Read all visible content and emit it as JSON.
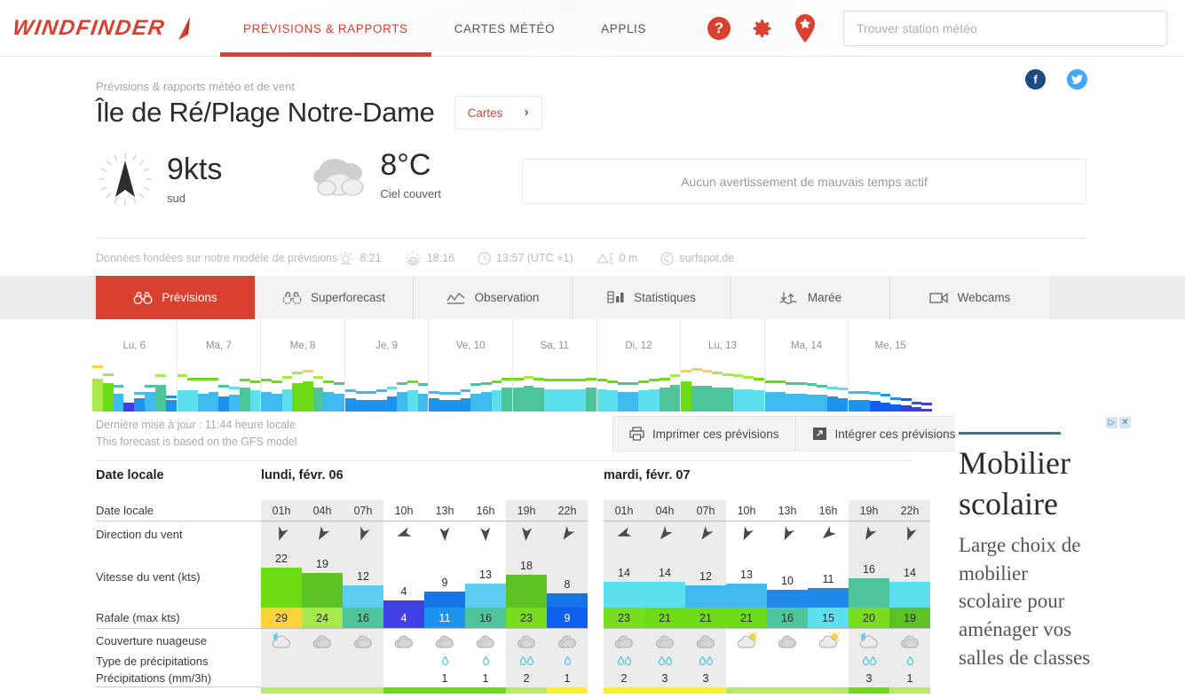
{
  "nav": {
    "logo_text": "WINDFINDER",
    "links": [
      {
        "label": "PRÉVISIONS & RAPPORTS",
        "active": true
      },
      {
        "label": "CARTES MÉTÉO",
        "active": false
      },
      {
        "label": "APPLIS",
        "active": false
      }
    ],
    "icons": [
      "help-icon",
      "gear-icon",
      "favorite-pin-icon"
    ],
    "search_placeholder": "Trouver station météo",
    "search_value": ""
  },
  "header": {
    "breadcrumb": "Prévisions & rapports météo et de vent",
    "title": "Île de Ré/Plage Notre-Dame",
    "cartes_label": "Cartes",
    "cartes_chevron": "›",
    "social": [
      {
        "name": "facebook-icon",
        "glyph": "f",
        "color": "#1d4a84"
      },
      {
        "name": "twitter-icon",
        "glyph": "ᴠ",
        "color": "#3fa9f5"
      }
    ]
  },
  "current": {
    "wind_value": "9kts",
    "wind_dir_label": "sud",
    "temp_value": "8°C",
    "sky_label": "Ciel couvert",
    "warning": "Aucun avertissement de mauvais temps actif"
  },
  "info_strip": {
    "model_text": "Données fondées sur notre modèle de prévisions",
    "items": [
      {
        "icon": "sunrise-icon",
        "value": "8:21"
      },
      {
        "icon": "sunset-icon",
        "value": "18:16"
      },
      {
        "icon": "clock-icon",
        "value": "13:57 (UTC +1)"
      },
      {
        "icon": "altitude-icon",
        "value": "0 m"
      },
      {
        "icon": "copyright-icon",
        "value": "surfspot.de"
      }
    ]
  },
  "tabs": [
    {
      "label": "Prévisions",
      "icon": "binoculars-icon",
      "active": true
    },
    {
      "label": "Superforecast",
      "icon": "binoculars-dotted-icon",
      "active": false
    },
    {
      "label": "Observation",
      "icon": "chart-line-icon",
      "active": false
    },
    {
      "label": "Statistiques",
      "icon": "bar-chart-icon",
      "active": false
    },
    {
      "label": "Marée",
      "icon": "tide-arrows-icon",
      "active": false
    },
    {
      "label": "Webcams",
      "icon": "webcam-icon",
      "active": false
    }
  ],
  "overview": {
    "days": [
      "Lu, 6",
      "Ma, 7",
      "Me, 8",
      "Je, 9",
      "Ve, 10",
      "Sa, 11",
      "Di, 12",
      "Lu, 13",
      "Ma, 14",
      "Me, 15"
    ],
    "series": [
      {
        "day": "Lu, 6",
        "wind": [
          22,
          19,
          12,
          4,
          9,
          13,
          18,
          8
        ],
        "gust": [
          29,
          24,
          16,
          4,
          11,
          16,
          23,
          9
        ]
      },
      {
        "day": "Ma, 7",
        "wind": [
          14,
          14,
          12,
          13,
          10,
          11,
          16,
          14
        ],
        "gust": [
          23,
          21,
          21,
          21,
          16,
          15,
          20,
          19
        ]
      },
      {
        "day": "Me, 8",
        "wind": [
          13,
          12,
          15,
          19,
          20,
          16,
          13,
          12
        ],
        "gust": [
          20,
          19,
          22,
          25,
          26,
          22,
          19,
          18
        ]
      },
      {
        "day": "Je, 9",
        "wind": [
          9,
          8,
          8,
          8,
          10,
          13,
          14,
          12
        ],
        "gust": [
          13,
          12,
          12,
          13,
          15,
          18,
          19,
          17
        ]
      },
      {
        "day": "Ve, 10",
        "wind": [
          9,
          8,
          8,
          9,
          12,
          13,
          14,
          16
        ],
        "gust": [
          12,
          11,
          11,
          13,
          17,
          18,
          19,
          21
        ]
      },
      {
        "day": "Sa, 11",
        "wind": [
          16,
          17,
          16,
          15,
          15,
          15,
          15,
          16
        ],
        "gust": [
          21,
          22,
          21,
          20,
          20,
          20,
          20,
          21
        ]
      },
      {
        "day": "Di, 12",
        "wind": [
          15,
          14,
          13,
          13,
          14,
          15,
          16,
          18
        ],
        "gust": [
          20,
          19,
          18,
          18,
          19,
          20,
          21,
          23
        ]
      },
      {
        "day": "Lu, 13",
        "wind": [
          20,
          17,
          17,
          16,
          16,
          15,
          15,
          14
        ],
        "gust": [
          26,
          27,
          26,
          25,
          24,
          23,
          22,
          21
        ]
      },
      {
        "day": "Ma, 14",
        "wind": [
          13,
          13,
          12,
          12,
          11,
          11,
          10,
          9
        ],
        "gust": [
          19,
          19,
          18,
          18,
          17,
          16,
          15,
          14
        ]
      },
      {
        "day": "Me, 15",
        "wind": [
          8,
          8,
          7,
          6,
          5,
          4,
          3,
          2
        ],
        "gust": [
          12,
          12,
          11,
          10,
          8,
          7,
          5,
          4
        ]
      }
    ]
  },
  "update": {
    "line1": "Dernière mise à jour : 11:44 heure locale",
    "line2": "This forecast is based on the GFS model"
  },
  "actions": [
    {
      "label": "Imprimer ces prévisions",
      "icon": "printer-icon"
    },
    {
      "label": "Intégrer ces prévisions",
      "icon": "embed-icon"
    }
  ],
  "forecast": {
    "section_title": "Date locale",
    "row_labels": [
      "Date locale",
      "Direction du vent",
      "Vitesse du vent  (kts)",
      "Rafale  (max kts)",
      "Couverture nuageuse",
      "Type de précipitations",
      "Précipitations  (mm/3h)"
    ],
    "times": [
      "01h",
      "04h",
      "07h",
      "10h",
      "13h",
      "16h",
      "19h",
      "22h"
    ],
    "shaded_cols": [
      0,
      1,
      2,
      6,
      7
    ],
    "days": [
      {
        "title": "lundi, févr. 06",
        "wind_dir_deg": [
          200,
          210,
          200,
          250,
          178,
          178,
          185,
          215
        ],
        "wind_speed": [
          22,
          19,
          12,
          4,
          9,
          13,
          18,
          8
        ],
        "wind_colors": [
          "#6bdd10",
          "#5cc122",
          "#5ccdee",
          "#3f3fe0",
          "#1574e6",
          "#5ccdee",
          "#5cc122",
          "#1574e6"
        ],
        "gust": [
          29,
          24,
          16,
          4,
          11,
          16,
          23,
          9
        ],
        "gust_colors": [
          "#ffd23b",
          "#a9e84a",
          "#4ec49a",
          "#4040e8",
          "#1d93ee",
          "#4ec49a",
          "#78dd1e",
          "#1060ef"
        ],
        "gust_text_colors": [
          "#2b2b2b",
          "#2b2b2b",
          "#2b2b2b",
          "#ffffff",
          "#ffffff",
          "#2b2b2b",
          "#2b2b2b",
          "#ffffff"
        ],
        "cloud": [
          "moon-cloud",
          "cloud",
          "cloud",
          "cloud",
          "cloud",
          "cloud",
          "cloud",
          "cloud"
        ],
        "precip_type": [
          0,
          0,
          0,
          0,
          1,
          1,
          2,
          1
        ],
        "precip": [
          "",
          "",
          "",
          "",
          "1",
          "1",
          "2",
          "1"
        ],
        "temp_colors": [
          "#b6e86a",
          "#b6e86a",
          "#b6e86a",
          "#6edb18",
          "#6edb18",
          "#6edb18",
          "#b6e86a",
          "#ffee22"
        ]
      },
      {
        "title": "mardi, févr. 07",
        "wind_dir_deg": [
          250,
          220,
          215,
          205,
          205,
          230,
          210,
          200
        ],
        "wind_speed": [
          14,
          14,
          12,
          13,
          10,
          11,
          16,
          14
        ],
        "wind_colors": [
          "#5ce0ee",
          "#5ce0ee",
          "#3fb9ee",
          "#3fb9ee",
          "#2189ea",
          "#2189ea",
          "#4ec49a",
          "#5ce0ee"
        ],
        "gust": [
          23,
          21,
          21,
          21,
          16,
          15,
          20,
          19
        ],
        "gust_colors": [
          "#78dd1e",
          "#6edb18",
          "#6edb18",
          "#6edb18",
          "#4ec49a",
          "#5ce0ee",
          "#78dd1e",
          "#5cc122"
        ],
        "gust_text_colors": [
          "#2b2b2b",
          "#2b2b2b",
          "#2b2b2b",
          "#2b2b2b",
          "#2b2b2b",
          "#2b2b2b",
          "#2b2b2b",
          "#2b2b2b"
        ],
        "cloud": [
          "cloud",
          "cloud",
          "cloud",
          "cloud-sun",
          "cloud",
          "cloud-sun",
          "moon-cloud",
          "cloud"
        ],
        "precip_type": [
          2,
          2,
          2,
          0,
          0,
          0,
          2,
          1
        ],
        "precip": [
          "2",
          "3",
          "3",
          "",
          "",
          "",
          "3",
          "1"
        ],
        "temp_colors": [
          "#ffee22",
          "#ffee22",
          "#ffee22",
          "#b6e86a",
          "#b6e86a",
          "#b6e86a",
          "#6edb18",
          "#b6e86a"
        ]
      }
    ]
  },
  "ad": {
    "title": "Mobilier scolaire",
    "body": "Large choix de mobilier scolaire pour aménager vos salles de classes",
    "ctrl_play": "▷",
    "ctrl_close": "✕"
  }
}
